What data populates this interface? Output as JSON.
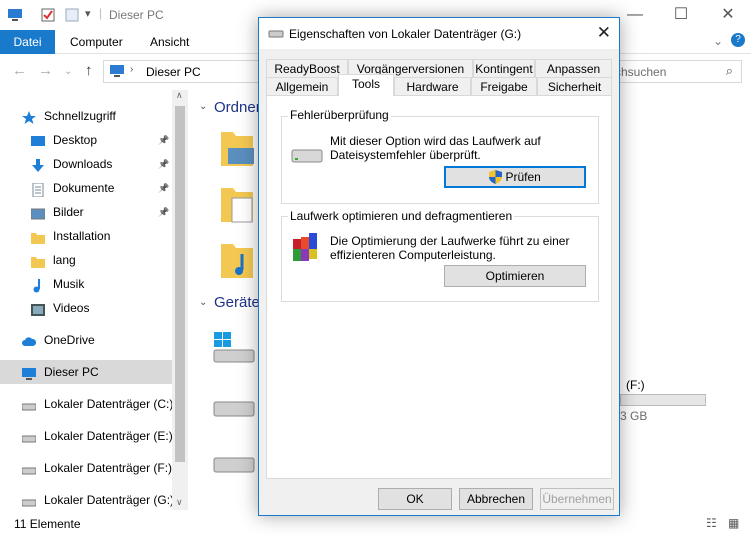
{
  "window": {
    "title": "Dieser PC",
    "minimize": "—",
    "maximize": "☐",
    "close": "✕"
  },
  "ribbon": {
    "tabs": [
      "Datei",
      "Computer",
      "Ansicht"
    ]
  },
  "address": {
    "path": "Dieser PC",
    "search_placeholder": "rchsuchen"
  },
  "nav": {
    "items": [
      {
        "label": "Schnellzugriff",
        "icon": "star-icon"
      },
      {
        "label": "Desktop",
        "icon": "desktop-icon",
        "pinned": true
      },
      {
        "label": "Downloads",
        "icon": "download-icon",
        "pinned": true
      },
      {
        "label": "Dokumente",
        "icon": "document-icon",
        "pinned": true
      },
      {
        "label": "Bilder",
        "icon": "pictures-icon",
        "pinned": true
      },
      {
        "label": "Installation",
        "icon": "folder-icon"
      },
      {
        "label": "lang",
        "icon": "folder-icon"
      },
      {
        "label": "Musik",
        "icon": "music-icon"
      },
      {
        "label": "Videos",
        "icon": "videos-icon"
      },
      {
        "label": "OneDrive",
        "icon": "cloud-icon"
      },
      {
        "label": "Dieser PC",
        "icon": "computer-icon",
        "selected": true
      },
      {
        "label": "Lokaler Datenträger (C:)",
        "icon": "drive-icon"
      },
      {
        "label": "Lokaler Datenträger (E:)",
        "icon": "drive-icon"
      },
      {
        "label": "Lokaler Datenträger (F:)",
        "icon": "drive-icon"
      },
      {
        "label": "Lokaler Datenträger (G:)",
        "icon": "drive-icon"
      }
    ]
  },
  "content": {
    "folders_header": "Ordner",
    "devices_header": "Geräte",
    "drive_label_partial": "(F:)",
    "drive_size_partial": "3 GB"
  },
  "status": {
    "count": "11 Elemente"
  },
  "dialog": {
    "title": "Eigenschaften von Lokaler Datenträger (G:)",
    "tabs_row1": [
      "ReadyBoost",
      "Vorgängerversionen",
      "Kontingent",
      "Anpassen"
    ],
    "tabs_row2": [
      "Allgemein",
      "Tools",
      "Hardware",
      "Freigabe",
      "Sicherheit"
    ],
    "active_tab": "Tools",
    "error_check": {
      "title": "Fehlerüberprüfung",
      "line1": "Mit dieser Option wird das Laufwerk auf",
      "line2": "Dateisystemfehler überprüft.",
      "button": "Prüfen"
    },
    "optimize": {
      "title": "Laufwerk optimieren und defragmentieren",
      "line1": "Die Optimierung der Laufwerke führt zu einer",
      "line2": "effizienteren Computerleistung.",
      "button": "Optimieren"
    },
    "buttons": {
      "ok": "OK",
      "cancel": "Abbrechen",
      "apply": "Übernehmen"
    }
  }
}
